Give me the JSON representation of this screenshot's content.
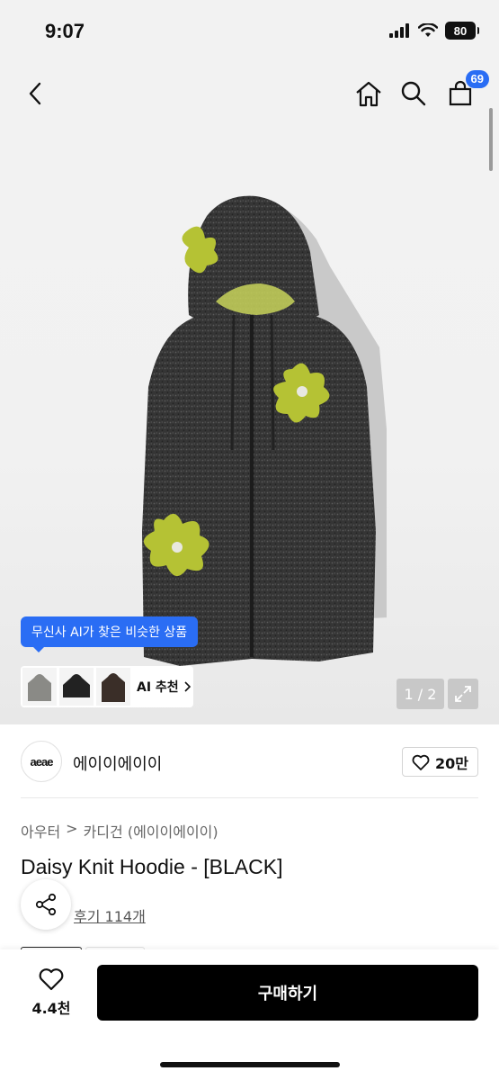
{
  "status_bar": {
    "time": "9:07",
    "battery": "80"
  },
  "nav": {
    "cart_count": "69"
  },
  "ai": {
    "tooltip": "무신사 AI가 찾은 비슷한 상품",
    "label": "AI 추천"
  },
  "gallery": {
    "pager": "1 / 2"
  },
  "brand": {
    "logo_text": "aeae",
    "name": "에이이에이이",
    "likes": "20만"
  },
  "breadcrumb": {
    "category": "아우터",
    "separator": ">",
    "subcategory": "카디건 (에이이에이이)"
  },
  "product": {
    "title": "Daisy Knit Hoodie - [BLACK]",
    "review_link": "후기 114개"
  },
  "bottom": {
    "wish_count": "4.4천",
    "buy_label": "구매하기"
  },
  "colors": {
    "accent": "#2a6df4",
    "buy_bg": "#000000",
    "hoodie": "#3a3a3a",
    "flower": "#b5c234"
  }
}
